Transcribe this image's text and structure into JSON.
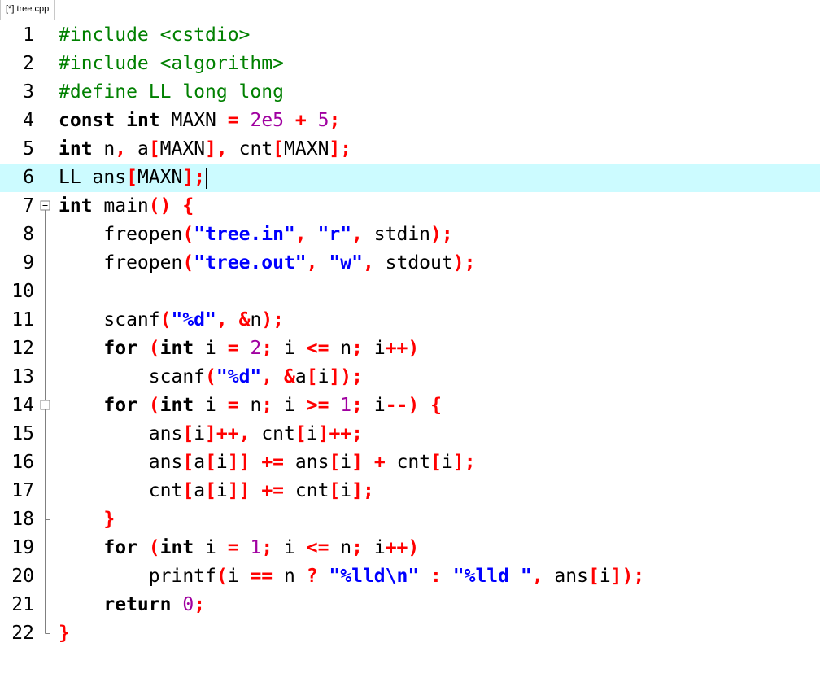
{
  "tab": {
    "title": "[*] tree.cpp"
  },
  "editor": {
    "current_line": 6,
    "lines": [
      {
        "n": "1",
        "fold": "none",
        "tokens": [
          [
            "pp",
            "#include <cstdio>"
          ]
        ]
      },
      {
        "n": "2",
        "fold": "none",
        "tokens": [
          [
            "pp",
            "#include <algorithm>"
          ]
        ]
      },
      {
        "n": "3",
        "fold": "none",
        "tokens": [
          [
            "pp",
            "#define LL long long"
          ]
        ]
      },
      {
        "n": "4",
        "fold": "none",
        "tokens": [
          [
            "kw",
            "const"
          ],
          [
            "id",
            " "
          ],
          [
            "kw",
            "int"
          ],
          [
            "id",
            " MAXN "
          ],
          [
            "sym",
            "="
          ],
          [
            "id",
            " "
          ],
          [
            "num",
            "2e5"
          ],
          [
            "id",
            " "
          ],
          [
            "sym",
            "+"
          ],
          [
            "id",
            " "
          ],
          [
            "num",
            "5"
          ],
          [
            "sym",
            ";"
          ]
        ]
      },
      {
        "n": "5",
        "fold": "none",
        "tokens": [
          [
            "kw",
            "int"
          ],
          [
            "id",
            " n"
          ],
          [
            "sym",
            ","
          ],
          [
            "id",
            " a"
          ],
          [
            "sym",
            "["
          ],
          [
            "id",
            "MAXN"
          ],
          [
            "sym",
            "]"
          ],
          [
            "sym",
            ","
          ],
          [
            "id",
            " cnt"
          ],
          [
            "sym",
            "["
          ],
          [
            "id",
            "MAXN"
          ],
          [
            "sym",
            "]"
          ],
          [
            "sym",
            ";"
          ]
        ]
      },
      {
        "n": "6",
        "fold": "none",
        "caret": true,
        "tokens": [
          [
            "id",
            "LL ans"
          ],
          [
            "sym",
            "["
          ],
          [
            "id",
            "MAXN"
          ],
          [
            "sym",
            "]"
          ],
          [
            "sym",
            ";"
          ]
        ]
      },
      {
        "n": "7",
        "fold": "open",
        "tokens": [
          [
            "kw",
            "int"
          ],
          [
            "id",
            " main"
          ],
          [
            "sym",
            "()"
          ],
          [
            "id",
            " "
          ],
          [
            "sym",
            "{"
          ]
        ]
      },
      {
        "n": "8",
        "fold": "bar",
        "tokens": [
          [
            "id",
            "    freopen"
          ],
          [
            "sym",
            "("
          ],
          [
            "str",
            "\"tree.in\""
          ],
          [
            "sym",
            ","
          ],
          [
            "id",
            " "
          ],
          [
            "str",
            "\"r\""
          ],
          [
            "sym",
            ","
          ],
          [
            "id",
            " stdin"
          ],
          [
            "sym",
            ")"
          ],
          [
            "sym",
            ";"
          ]
        ]
      },
      {
        "n": "9",
        "fold": "bar",
        "tokens": [
          [
            "id",
            "    freopen"
          ],
          [
            "sym",
            "("
          ],
          [
            "str",
            "\"tree.out\""
          ],
          [
            "sym",
            ","
          ],
          [
            "id",
            " "
          ],
          [
            "str",
            "\"w\""
          ],
          [
            "sym",
            ","
          ],
          [
            "id",
            " stdout"
          ],
          [
            "sym",
            ")"
          ],
          [
            "sym",
            ";"
          ]
        ]
      },
      {
        "n": "10",
        "fold": "bar",
        "tokens": []
      },
      {
        "n": "11",
        "fold": "bar",
        "tokens": [
          [
            "id",
            "    scanf"
          ],
          [
            "sym",
            "("
          ],
          [
            "str",
            "\"%d\""
          ],
          [
            "sym",
            ","
          ],
          [
            "id",
            " "
          ],
          [
            "sym",
            "&"
          ],
          [
            "id",
            "n"
          ],
          [
            "sym",
            ")"
          ],
          [
            "sym",
            ";"
          ]
        ]
      },
      {
        "n": "12",
        "fold": "bar",
        "tokens": [
          [
            "id",
            "    "
          ],
          [
            "kw",
            "for"
          ],
          [
            "id",
            " "
          ],
          [
            "sym",
            "("
          ],
          [
            "kw",
            "int"
          ],
          [
            "id",
            " i "
          ],
          [
            "sym",
            "="
          ],
          [
            "id",
            " "
          ],
          [
            "num",
            "2"
          ],
          [
            "sym",
            ";"
          ],
          [
            "id",
            " i "
          ],
          [
            "sym",
            "<="
          ],
          [
            "id",
            " n"
          ],
          [
            "sym",
            ";"
          ],
          [
            "id",
            " i"
          ],
          [
            "sym",
            "++"
          ],
          [
            "sym",
            ")"
          ]
        ]
      },
      {
        "n": "13",
        "fold": "bar",
        "tokens": [
          [
            "id",
            "        scanf"
          ],
          [
            "sym",
            "("
          ],
          [
            "str",
            "\"%d\""
          ],
          [
            "sym",
            ","
          ],
          [
            "id",
            " "
          ],
          [
            "sym",
            "&"
          ],
          [
            "id",
            "a"
          ],
          [
            "sym",
            "["
          ],
          [
            "id",
            "i"
          ],
          [
            "sym",
            "]"
          ],
          [
            "sym",
            ")"
          ],
          [
            "sym",
            ";"
          ]
        ]
      },
      {
        "n": "14",
        "fold": "open-inner",
        "tokens": [
          [
            "id",
            "    "
          ],
          [
            "kw",
            "for"
          ],
          [
            "id",
            " "
          ],
          [
            "sym",
            "("
          ],
          [
            "kw",
            "int"
          ],
          [
            "id",
            " i "
          ],
          [
            "sym",
            "="
          ],
          [
            "id",
            " n"
          ],
          [
            "sym",
            ";"
          ],
          [
            "id",
            " i "
          ],
          [
            "sym",
            ">="
          ],
          [
            "id",
            " "
          ],
          [
            "num",
            "1"
          ],
          [
            "sym",
            ";"
          ],
          [
            "id",
            " i"
          ],
          [
            "sym",
            "--"
          ],
          [
            "sym",
            ")"
          ],
          [
            "id",
            " "
          ],
          [
            "sym",
            "{"
          ]
        ]
      },
      {
        "n": "15",
        "fold": "bar",
        "tokens": [
          [
            "id",
            "        ans"
          ],
          [
            "sym",
            "["
          ],
          [
            "id",
            "i"
          ],
          [
            "sym",
            "]"
          ],
          [
            "sym",
            "++"
          ],
          [
            "sym",
            ","
          ],
          [
            "id",
            " cnt"
          ],
          [
            "sym",
            "["
          ],
          [
            "id",
            "i"
          ],
          [
            "sym",
            "]"
          ],
          [
            "sym",
            "++"
          ],
          [
            "sym",
            ";"
          ]
        ]
      },
      {
        "n": "16",
        "fold": "bar",
        "tokens": [
          [
            "id",
            "        ans"
          ],
          [
            "sym",
            "["
          ],
          [
            "id",
            "a"
          ],
          [
            "sym",
            "["
          ],
          [
            "id",
            "i"
          ],
          [
            "sym",
            "]]"
          ],
          [
            "id",
            " "
          ],
          [
            "sym",
            "+="
          ],
          [
            "id",
            " ans"
          ],
          [
            "sym",
            "["
          ],
          [
            "id",
            "i"
          ],
          [
            "sym",
            "]"
          ],
          [
            "id",
            " "
          ],
          [
            "sym",
            "+"
          ],
          [
            "id",
            " cnt"
          ],
          [
            "sym",
            "["
          ],
          [
            "id",
            "i"
          ],
          [
            "sym",
            "]"
          ],
          [
            "sym",
            ";"
          ]
        ]
      },
      {
        "n": "17",
        "fold": "bar",
        "tokens": [
          [
            "id",
            "        cnt"
          ],
          [
            "sym",
            "["
          ],
          [
            "id",
            "a"
          ],
          [
            "sym",
            "["
          ],
          [
            "id",
            "i"
          ],
          [
            "sym",
            "]]"
          ],
          [
            "id",
            " "
          ],
          [
            "sym",
            "+="
          ],
          [
            "id",
            " cnt"
          ],
          [
            "sym",
            "["
          ],
          [
            "id",
            "i"
          ],
          [
            "sym",
            "]"
          ],
          [
            "sym",
            ";"
          ]
        ]
      },
      {
        "n": "18",
        "fold": "end-inner",
        "tokens": [
          [
            "id",
            "    "
          ],
          [
            "sym",
            "}"
          ]
        ]
      },
      {
        "n": "19",
        "fold": "bar",
        "tokens": [
          [
            "id",
            "    "
          ],
          [
            "kw",
            "for"
          ],
          [
            "id",
            " "
          ],
          [
            "sym",
            "("
          ],
          [
            "kw",
            "int"
          ],
          [
            "id",
            " i "
          ],
          [
            "sym",
            "="
          ],
          [
            "id",
            " "
          ],
          [
            "num",
            "1"
          ],
          [
            "sym",
            ";"
          ],
          [
            "id",
            " i "
          ],
          [
            "sym",
            "<="
          ],
          [
            "id",
            " n"
          ],
          [
            "sym",
            ";"
          ],
          [
            "id",
            " i"
          ],
          [
            "sym",
            "++"
          ],
          [
            "sym",
            ")"
          ]
        ]
      },
      {
        "n": "20",
        "fold": "bar",
        "tokens": [
          [
            "id",
            "        printf"
          ],
          [
            "sym",
            "("
          ],
          [
            "id",
            "i "
          ],
          [
            "sym",
            "=="
          ],
          [
            "id",
            " n "
          ],
          [
            "sym",
            "?"
          ],
          [
            "id",
            " "
          ],
          [
            "str",
            "\"%lld\\n\""
          ],
          [
            "id",
            " "
          ],
          [
            "sym",
            ":"
          ],
          [
            "id",
            " "
          ],
          [
            "str",
            "\"%lld \""
          ],
          [
            "sym",
            ","
          ],
          [
            "id",
            " ans"
          ],
          [
            "sym",
            "["
          ],
          [
            "id",
            "i"
          ],
          [
            "sym",
            "]"
          ],
          [
            "sym",
            ")"
          ],
          [
            "sym",
            ";"
          ]
        ]
      },
      {
        "n": "21",
        "fold": "bar",
        "tokens": [
          [
            "id",
            "    "
          ],
          [
            "kw",
            "return"
          ],
          [
            "id",
            " "
          ],
          [
            "num",
            "0"
          ],
          [
            "sym",
            ";"
          ]
        ]
      },
      {
        "n": "22",
        "fold": "end",
        "tokens": [
          [
            "sym",
            "}"
          ]
        ]
      }
    ]
  }
}
